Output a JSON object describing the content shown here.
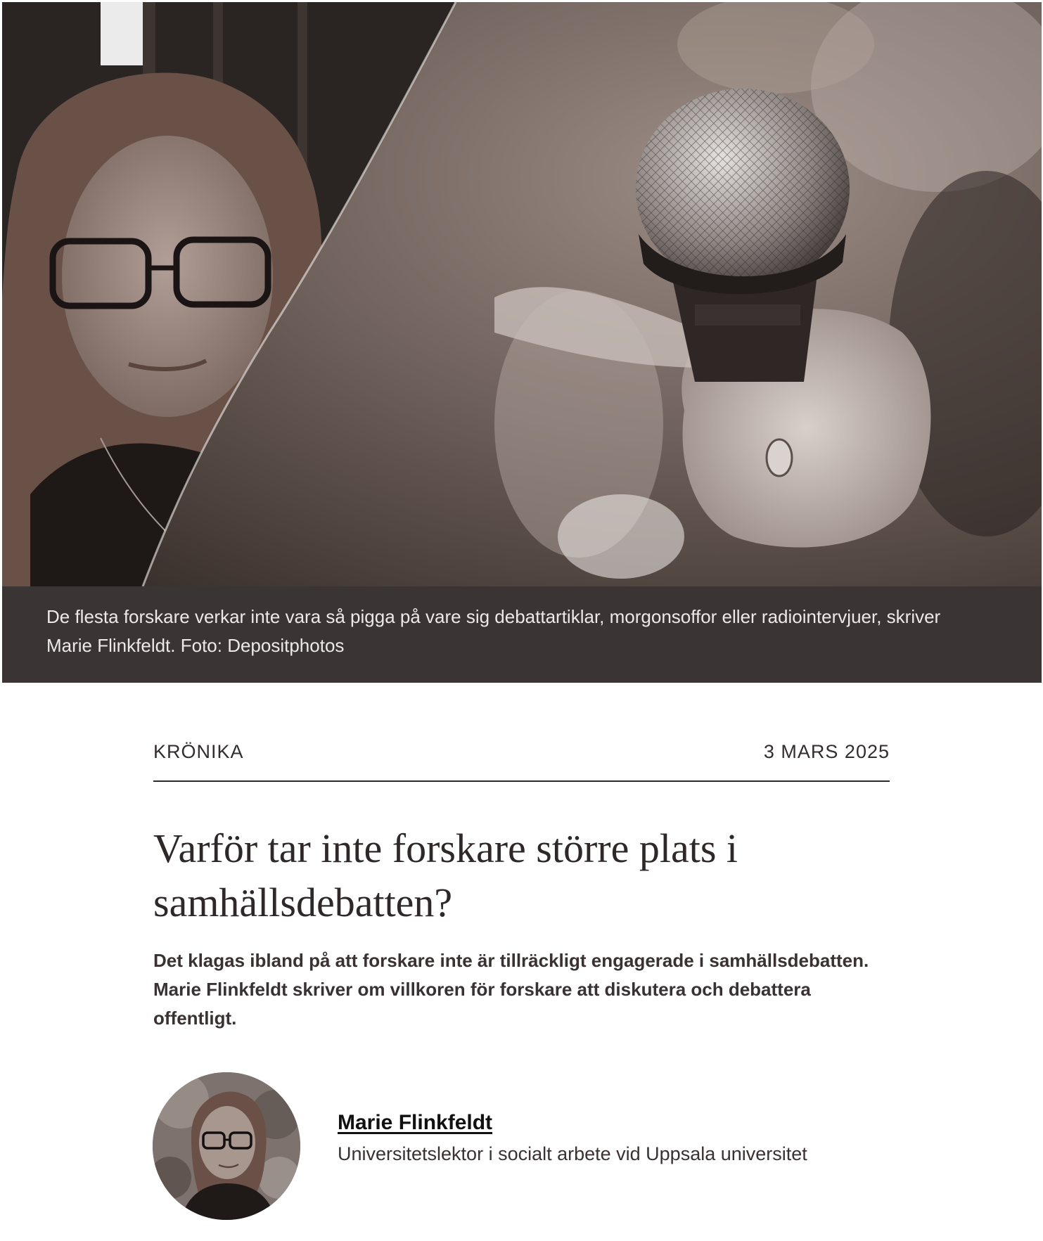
{
  "hero": {
    "image_description_icon": "photo-icon",
    "caption": "De flesta forskare verkar inte vara så pigga på vare sig debattartiklar, morgonsoffor eller radiointervjuer, skriver Marie Flinkfeldt. Foto: Depositphotos"
  },
  "article": {
    "category": "KRÖNIKA",
    "date": "3 MARS 2025",
    "headline": "Varför tar inte forskare större plats i samhällsdebatten?",
    "lead": "Det klagas ibland på att forskare inte är tillräckligt engagerade i samhällsdebatten. Marie Flinkfeldt skriver om villkoren för forskare att diskutera och debattera offentligt."
  },
  "author": {
    "name": "Marie Flinkfeldt",
    "title": "Universitetslektor i socialt arbete vid Uppsala universitet"
  },
  "colors": {
    "caption_bg": "#3a3434",
    "text": "#332e2e",
    "rule": "#2e2a2a"
  }
}
